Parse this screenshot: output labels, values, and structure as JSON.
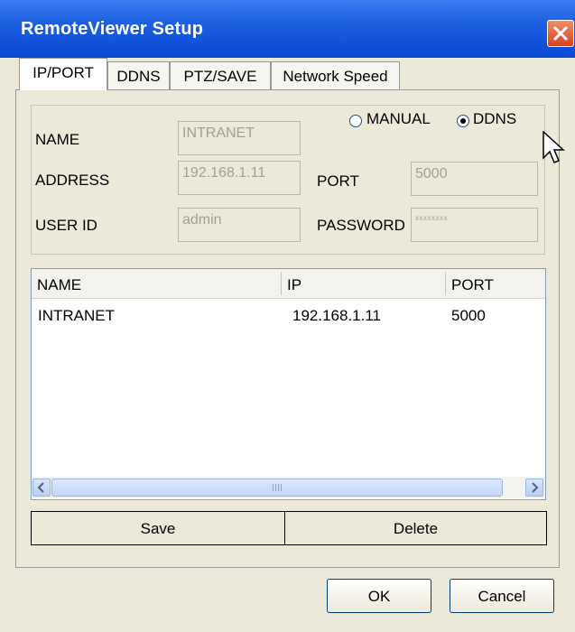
{
  "window": {
    "title": "RemoteViewer Setup"
  },
  "tabs": [
    {
      "label": "IP/PORT",
      "active": true
    },
    {
      "label": "DDNS",
      "active": false
    },
    {
      "label": "PTZ/SAVE",
      "active": false
    },
    {
      "label": "Network Speed",
      "active": false
    }
  ],
  "form": {
    "mode": {
      "manual_label": "MANUAL",
      "ddns_label": "DDNS",
      "selected": "DDNS"
    },
    "name": {
      "label": "NAME",
      "value": "INTRANET"
    },
    "address": {
      "label": "ADDRESS",
      "value": "192.168.1.11"
    },
    "port": {
      "label": "PORT",
      "value": "5000"
    },
    "user_id": {
      "label": "USER ID",
      "value": "admin"
    },
    "password": {
      "label": "PASSWORD",
      "value": "xxxxxxxx"
    }
  },
  "list": {
    "columns": [
      "NAME",
      "IP",
      "PORT"
    ],
    "rows": [
      {
        "name": "INTRANET",
        "ip": "192.168.1.11",
        "port": "5000"
      }
    ]
  },
  "buttons": {
    "save": "Save",
    "delete": "Delete",
    "ok": "OK",
    "cancel": "Cancel"
  },
  "colors": {
    "titlebar": "#0a49d4",
    "window_bg": "#ece9d8",
    "close_button": "#d8401e"
  }
}
